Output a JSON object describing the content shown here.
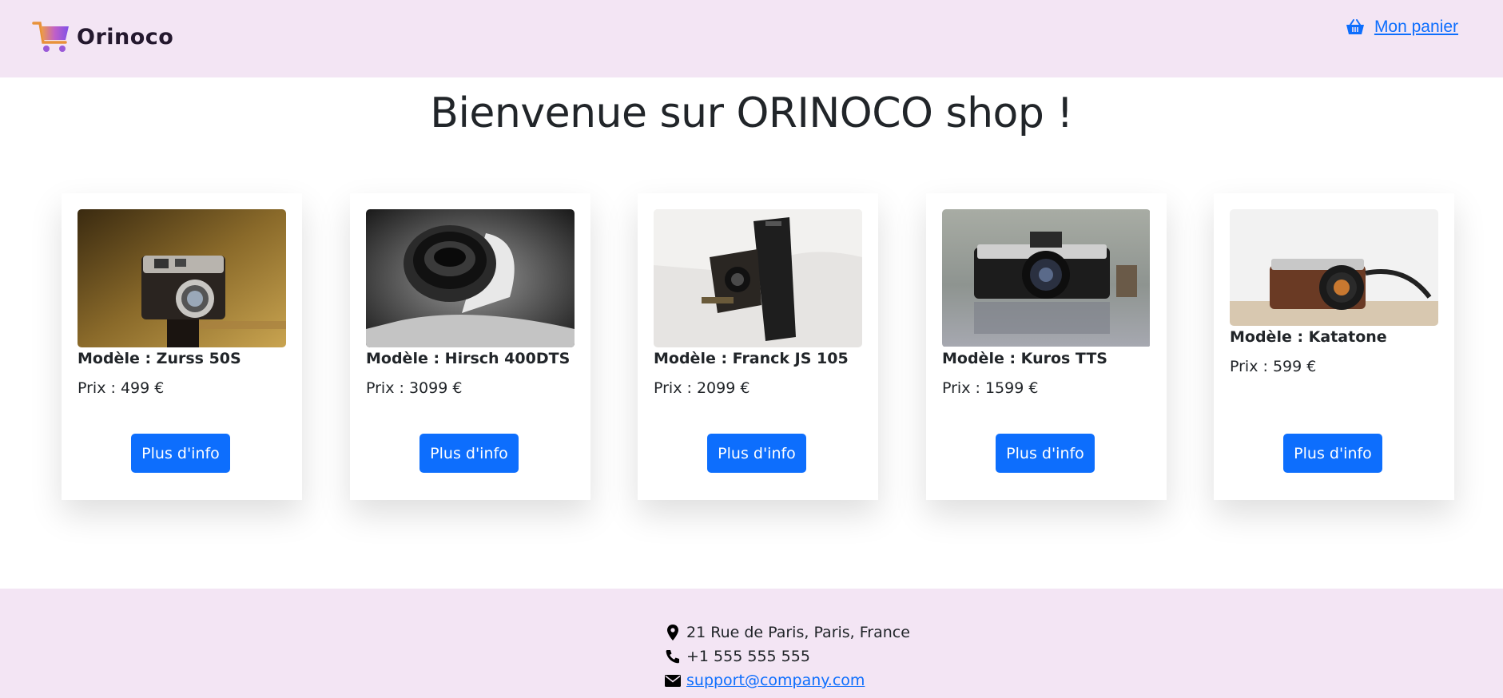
{
  "header": {
    "brand": "Orinoco",
    "cart_link": "Mon panier",
    "logo_icon": "shopping-cart-icon",
    "cart_icon": "basket-icon"
  },
  "main": {
    "title": "Bienvenue sur ORINOCO shop !"
  },
  "products": [
    {
      "model": "Modèle : Zurss 50S",
      "price": "Prix : 499 €",
      "button": "Plus d'info"
    },
    {
      "model": "Modèle : Hirsch 400DTS",
      "price": "Prix : 3099 €",
      "button": "Plus d'info"
    },
    {
      "model": "Modèle : Franck JS 105",
      "price": "Prix : 2099 €",
      "button": "Plus d'info"
    },
    {
      "model": "Modèle : Kuros TTS",
      "price": "Prix : 1599 €",
      "button": "Plus d'info"
    },
    {
      "model": "Modèle : Katatone",
      "price": "Prix : 599 €",
      "button": "Plus d'info"
    }
  ],
  "footer": {
    "address": "21 Rue de Paris, Paris, France",
    "phone": "+1 555 555 555",
    "email": "support@company.com",
    "address_icon": "map-marker-icon",
    "phone_icon": "phone-icon",
    "email_icon": "envelope-icon"
  },
  "colors": {
    "header_bg": "#f3e5f4",
    "primary": "#0d6efd"
  }
}
